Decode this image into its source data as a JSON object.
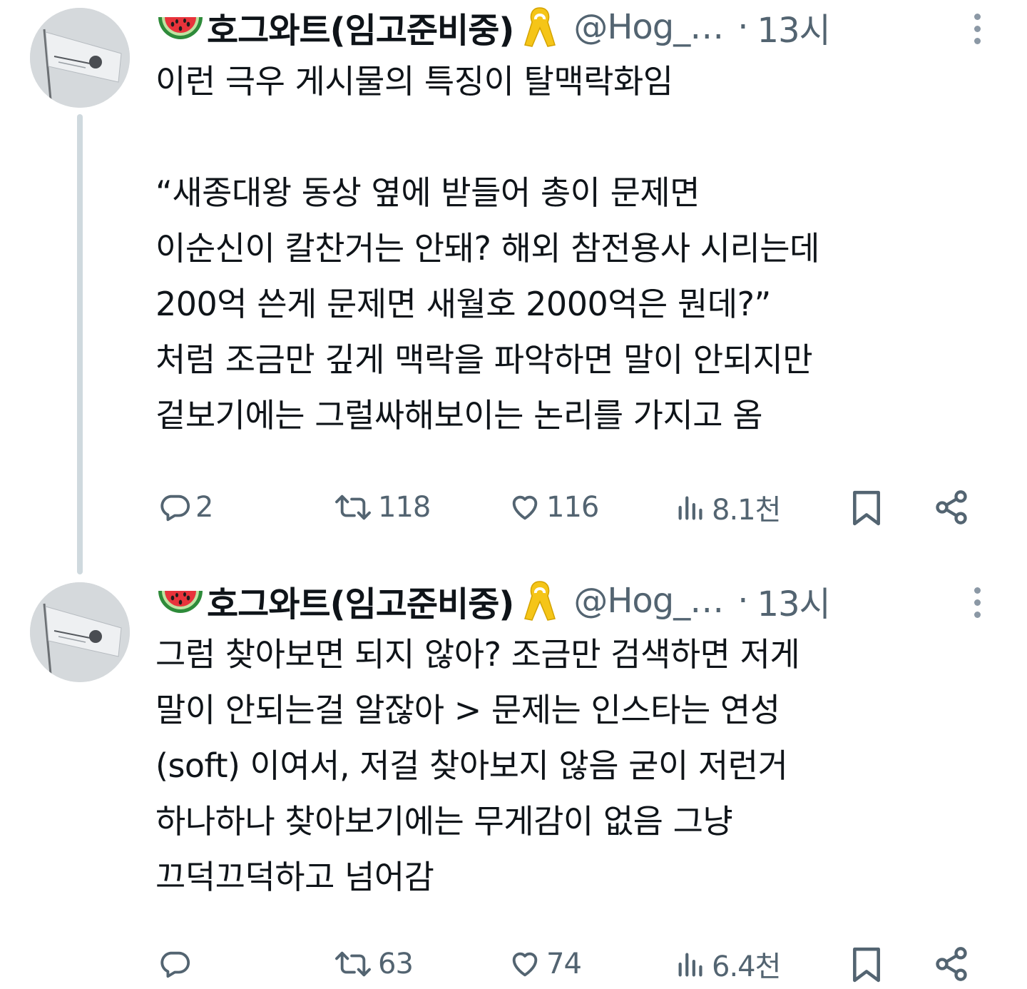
{
  "colors": {
    "text_primary": "#0f1419",
    "text_secondary": "#536471",
    "thread_line": "#cfd9de",
    "ribbon_yellow": "#f5c518"
  },
  "tweets": [
    {
      "emoji_icon": "watermelon-icon",
      "display_name": "호그와트(임고준비중)",
      "badge_icon": "yellow-ribbon-icon",
      "handle": "@Hog_…",
      "separator": "·",
      "time": "13시",
      "text": "이런 극우 게시물의 특징이 탈맥락화임\n\n“새종대왕 동상 옆에 받들어 총이 문제면\n이순신이 칼찬거는 안돼? 해외 참전용사 시리는데\n200억 쓴게 문제면 새월호 2000억은 뭔데?”\n처럼 조금만 깊게 맥락을 파악하면 말이 안되지만\n겉보기에는 그럴싸해보이는 논리를 가지고 옴",
      "replies": "2",
      "reposts": "118",
      "likes": "116",
      "views": "8.1천"
    },
    {
      "emoji_icon": "watermelon-icon",
      "display_name": "호그와트(임고준비중)",
      "badge_icon": "yellow-ribbon-icon",
      "handle": "@Hog_…",
      "separator": "·",
      "time": "13시",
      "text": "그럼 찾아보면 되지 않아? 조금만 검색하면 저게\n말이 안되는걸 알잖아 > 문제는 인스타는 연성\n(soft) 이여서, 저걸 찾아보지 않음 굳이 저런거\n하나하나 찾아보기에는 무게감이 없음 그냥\n끄덕끄덕하고 넘어감",
      "replies": "",
      "reposts": "63",
      "likes": "74",
      "views": "6.4천"
    }
  ]
}
